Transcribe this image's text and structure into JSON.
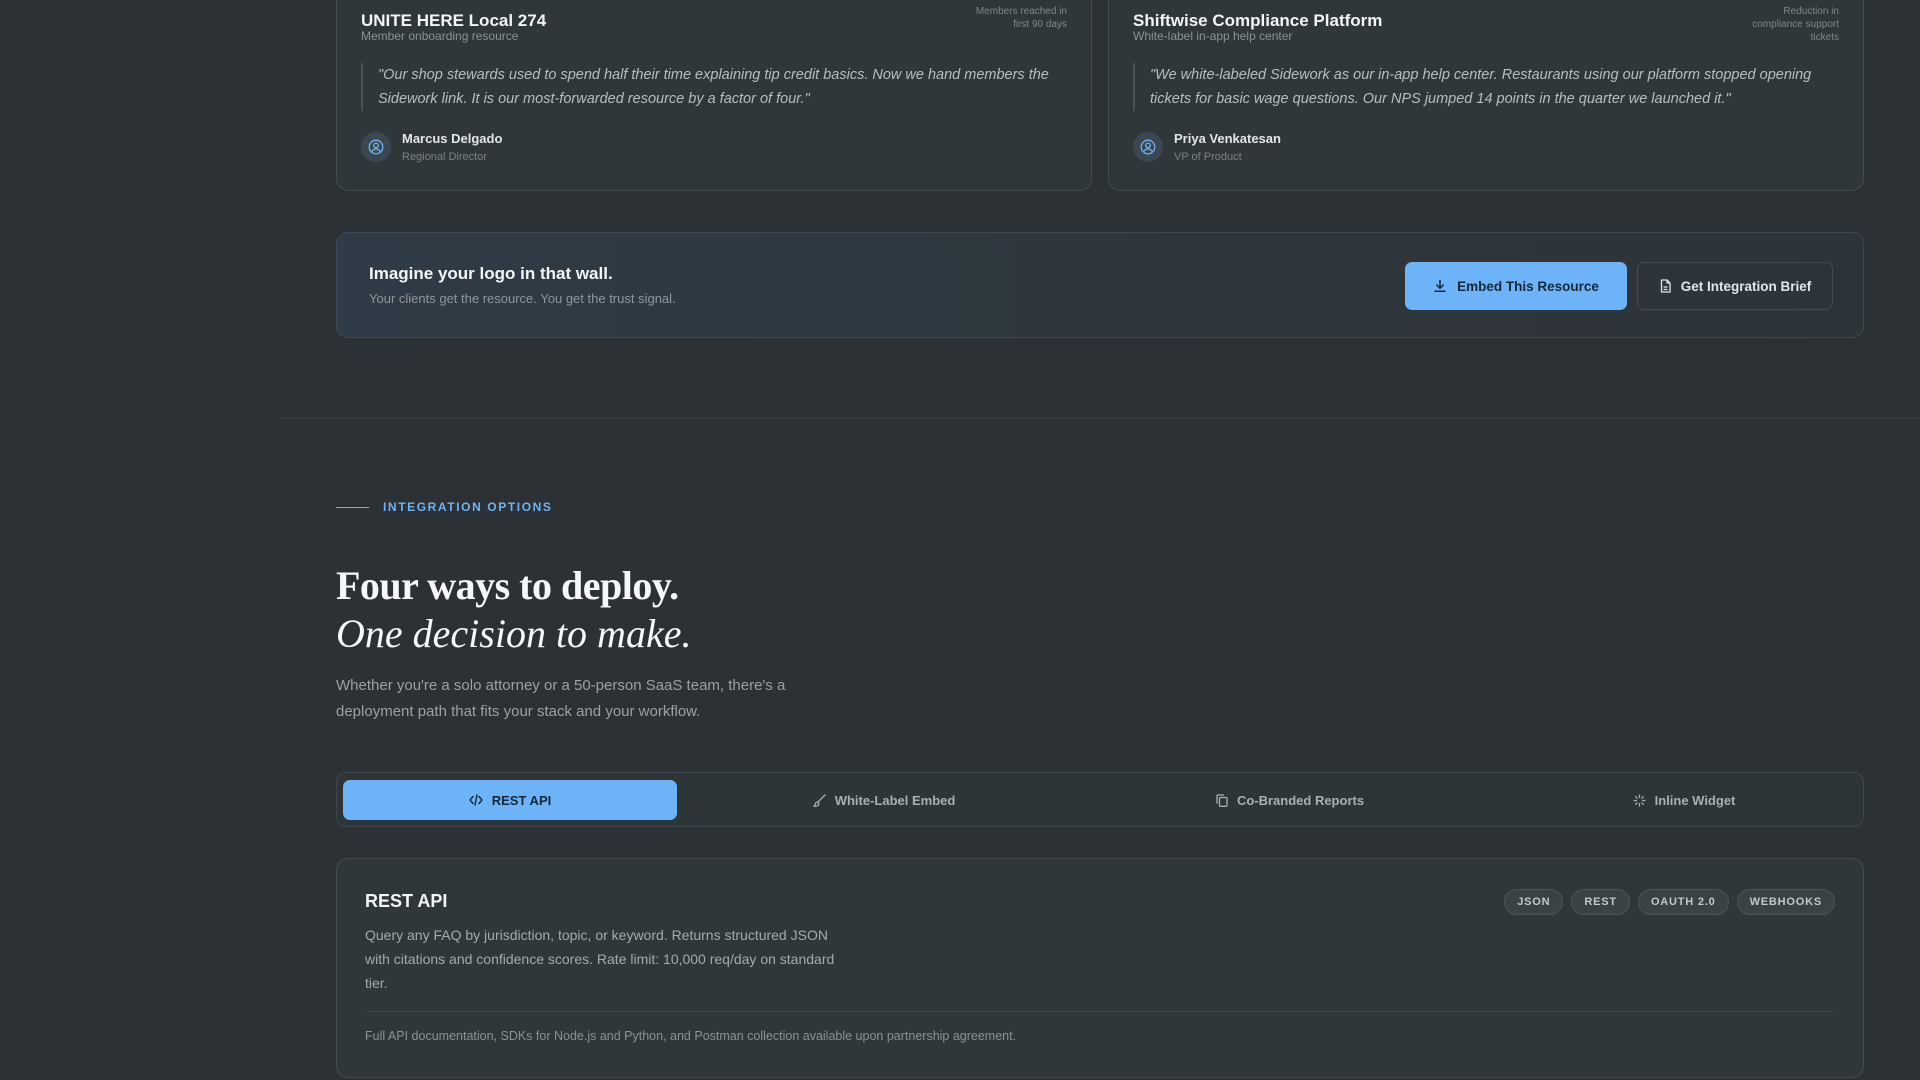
{
  "testimonials": [
    {
      "org": "UNITE HERE Local 274",
      "subtitle": "Member onboarding resource",
      "stat_label": "Members reached in first 90 days",
      "stat_line1": "Members reached in",
      "stat_line2": "first 90 days",
      "quote": "\"Our shop stewards used to spend half their time explaining tip credit basics. Now we hand members the Sidework link. It is our most-forwarded resource by a factor of four.\"",
      "author_name": "Marcus Delgado",
      "author_role": "Regional Director",
      "avatar_icon": "user-circle-icon"
    },
    {
      "org": "Shiftwise Compliance Platform",
      "subtitle": "White-label in-app help center",
      "stat_line1": "Reduction in",
      "stat_line2": "compliance support",
      "stat_line3": "tickets",
      "quote": "\"We white-labeled Sidework as our in-app help center. Restaurants using our platform stopped opening tickets for basic wage questions. Our NPS jumped 14 points in the quarter we launched it.\"",
      "author_name": "Priya Venkatesan",
      "author_role": "VP of Product",
      "avatar_icon": "user-circle-icon"
    }
  ],
  "cta": {
    "heading": "Imagine your logo in that wall.",
    "subtext": "Your clients get the resource. You get the trust signal.",
    "primary_label": "Embed This Resource",
    "primary_icon": "download-icon",
    "secondary_label": "Get Integration Brief",
    "secondary_icon": "document-icon"
  },
  "integration": {
    "eyebrow": "INTEGRATION OPTIONS",
    "headline_1": "Four ways to deploy.",
    "headline_2": "One decision to make.",
    "lede": "Whether you're a solo attorney or a 50-person SaaS team, there's a deployment path that fits your stack and your workflow.",
    "tabs": [
      {
        "label": "REST API",
        "icon": "code-icon",
        "active": true
      },
      {
        "label": "White-Label Embed",
        "icon": "brush-icon",
        "active": false
      },
      {
        "label": "Co-Branded Reports",
        "icon": "copy-icon",
        "active": false
      },
      {
        "label": "Inline Widget",
        "icon": "sparkle-icon",
        "active": false
      }
    ],
    "panel": {
      "title": "REST API",
      "description": "Query any FAQ by jurisdiction, topic, or keyword. Returns structured JSON with citations and confidence scores. Rate limit: 10,000 req/day on standard tier.",
      "tags": [
        "JSON",
        "REST",
        "OAUTH 2.0",
        "WEBHOOKS"
      ],
      "footnote": "Full API documentation, SDKs for Node.js and Python, and Postman collection available upon partnership agreement."
    }
  },
  "colors": {
    "background": "#2b3135",
    "accent": "#6db3f7",
    "card": "#30373b"
  }
}
